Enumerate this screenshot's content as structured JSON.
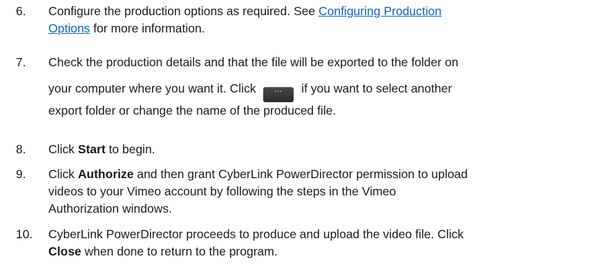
{
  "steps": [
    {
      "number": "6.",
      "line1_before": "Configure the production options as required. See ",
      "link_part1": "Configuring Production",
      "link_part2": "Options",
      "line2_after": " for more information."
    },
    {
      "number": "7.",
      "line1": "Check the production details and that the file will be exported to the folder on",
      "line2_before": "your computer where you want it. Click ",
      "line2_after": " if you want to select another",
      "line3": "export folder or change the name of the produced file.",
      "button_icon": "ellipsis-icon",
      "button_glyph": "…"
    },
    {
      "number": "8.",
      "before": "Click ",
      "bold": "Start",
      "after": " to begin."
    },
    {
      "number": "9.",
      "line1_before": "Click ",
      "bold": "Authorize",
      "line1_after": " and then grant CyberLink PowerDirector permission to upload",
      "line2": "videos to your Vimeo account by following the steps in the Vimeo",
      "line3": "Authorization windows."
    },
    {
      "number": "10.",
      "line1": "CyberLink PowerDirector proceeds to produce and upload the video file. Click",
      "bold": "Close",
      "line2_after": " when done to return to the program."
    }
  ],
  "colors": {
    "link": "#0b63c7",
    "text": "#1a1a1a"
  }
}
